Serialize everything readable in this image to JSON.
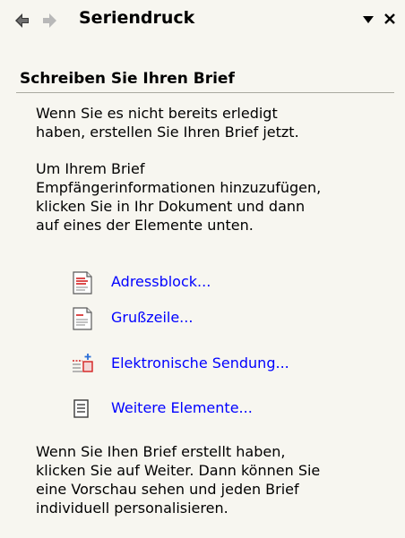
{
  "pane": {
    "title": "Seriendruck",
    "icons": {
      "back": "arrow-left-icon",
      "forward": "arrow-right-icon",
      "menu": "dropdown-arrow-icon",
      "close": "close-icon"
    }
  },
  "section": {
    "heading": "Schreiben Sie Ihren Brief"
  },
  "intro": {
    "lines": [
      "Wenn Sie es nicht bereits erledigt",
      "haben, erstellen Sie Ihren Brief jetzt."
    ]
  },
  "instruction": {
    "lines": [
      "Um Ihrem Brief",
      "Empfängerinformationen hinzuzufügen,",
      "klicken Sie in Ihr Dokument und dann",
      "auf eines der Elemente unten."
    ]
  },
  "links": [
    {
      "label": "Adressblock...",
      "icon": "address-block-icon"
    },
    {
      "label": "Grußzeile...",
      "icon": "greeting-line-icon"
    },
    {
      "label": "Elektronische Sendung...",
      "icon": "electronic-postage-icon"
    },
    {
      "label": "Weitere Elemente...",
      "icon": "more-items-icon"
    }
  ],
  "outro": {
    "lines": [
      "Wenn Sie Ihen Brief erstellt haben,",
      "klicken Sie auf Weiter. Dann können Sie",
      "eine Vorschau sehen und jeden Brief",
      "individuell personalisieren."
    ]
  },
  "colors": {
    "background": "#f7f6f0",
    "link": "#0000ff",
    "rule": "#a9a9a0",
    "accent_red": "#d42020"
  }
}
